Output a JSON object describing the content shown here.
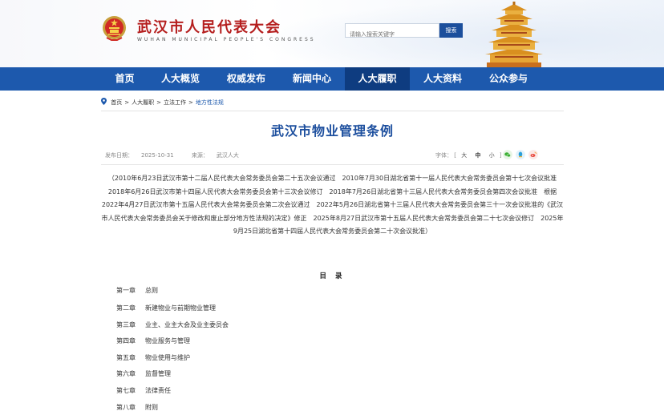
{
  "header": {
    "title": "武汉市人民代表大会",
    "subtitle": "WUHAN MUNICIPAL PEOPLE'S CONGRESS",
    "search_placeholder": "请输入搜索关键字",
    "search_button": "搜索"
  },
  "nav": {
    "items": [
      {
        "label": "首页"
      },
      {
        "label": "人大概览"
      },
      {
        "label": "权威发布"
      },
      {
        "label": "新闻中心"
      },
      {
        "label": "人大履职"
      },
      {
        "label": "人大资料"
      },
      {
        "label": "公众参与"
      }
    ],
    "active_index": 4
  },
  "breadcrumb": {
    "items": [
      "首页",
      "人大履职",
      "立法工作",
      "地方性法规"
    ],
    "separator": ">"
  },
  "article": {
    "title": "武汉市物业管理条例",
    "date_label": "发布日期：",
    "date": "2025-10-31",
    "source_label": "来源：",
    "source": "武汉人大",
    "font_label": "字体：",
    "font_open": "[",
    "font_large": "大",
    "font_medium": "中",
    "font_small": "小",
    "font_close": "]",
    "preamble": "（2010年6月23日武汉市第十二届人民代表大会常务委员会第二十五次会议通过　2010年7月30日湖北省第十一届人民代表大会常务委员会第十七次会议批准　2018年6月26日武汉市第十四届人民代表大会常务委员会第十三次会议修订　2018年7月26日湖北省第十三届人民代表大会常务委员会第四次会议批准　根据2022年4月27日武汉市第十五届人民代表大会常务委员会第二次会议通过　2022年5月26日湖北省第十三届人民代表大会常务委员会第三十一次会议批准的《武汉市人民代表大会常务委员会关于修改和废止部分地方性法规的决定》修正　2025年8月27日武汉市第十五届人民代表大会常务委员会第二十七次会议修订　2025年9月25日湖北省第十四届人民代表大会常务委员会第二十次会议批准）"
  },
  "toc": {
    "title": "目 录",
    "items": [
      {
        "chapter": "第一章",
        "name": "总则"
      },
      {
        "chapter": "第二章",
        "name": "新建物业与前期物业管理"
      },
      {
        "chapter": "第三章",
        "name": "业主、业主大会及业主委员会"
      },
      {
        "chapter": "第四章",
        "name": "物业服务与管理"
      },
      {
        "chapter": "第五章",
        "name": "物业使用与维护"
      },
      {
        "chapter": "第六章",
        "name": "监督管理"
      },
      {
        "chapter": "第七章",
        "name": "法律责任"
      },
      {
        "chapter": "第八章",
        "name": "附则"
      }
    ]
  },
  "colors": {
    "nav_bg": "#1d59ad",
    "nav_active": "#0e3c80",
    "title_red": "#b51e1e",
    "article_title": "#1d4f9e",
    "share_wechat": "#3cb034",
    "share_qq": "#2a9fd8",
    "share_weibo": "#e8473c"
  },
  "icons": [
    "national-emblem-icon",
    "location-pin-icon",
    "wechat-icon",
    "qq-icon",
    "weibo-icon",
    "yellow-crane-tower-icon"
  ]
}
